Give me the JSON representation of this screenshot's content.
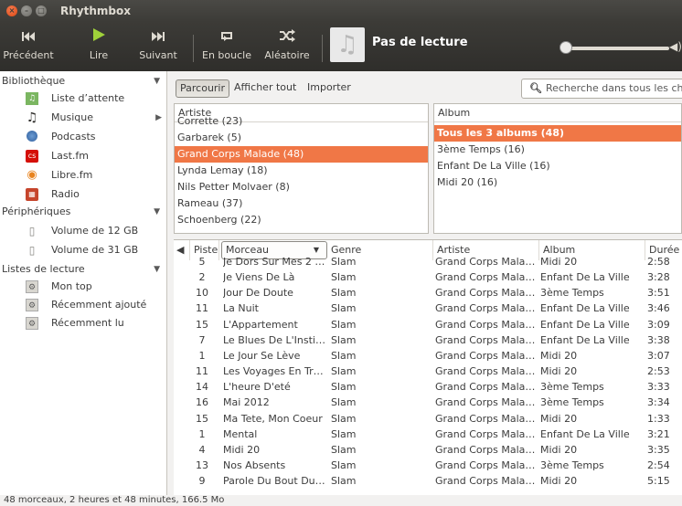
{
  "window": {
    "title": "Rhythmbox"
  },
  "toolbar": {
    "previous": "Précédent",
    "play": "Lire",
    "next": "Suivant",
    "repeat": "En boucle",
    "shuffle": "Aléatoire",
    "now_playing": "Pas de lecture"
  },
  "sidebar": {
    "library_header": "Bibliothèque",
    "library_items": [
      {
        "label": "Liste d’attente",
        "icon": "queue-icon"
      },
      {
        "label": "Musique",
        "icon": "music-icon"
      },
      {
        "label": "Podcasts",
        "icon": "podcast-icon"
      },
      {
        "label": "Last.fm",
        "icon": "lastfm-icon"
      },
      {
        "label": "Libre.fm",
        "icon": "librefm-icon"
      },
      {
        "label": "Radio",
        "icon": "radio-icon"
      }
    ],
    "devices_header": "Périphériques",
    "device_items": [
      {
        "label": "Volume de 12 GB"
      },
      {
        "label": "Volume de 31 GB"
      }
    ],
    "playlists_header": "Listes de lecture",
    "playlist_items": [
      {
        "label": "Mon top"
      },
      {
        "label": "Récemment ajouté"
      },
      {
        "label": "Récemment lu"
      }
    ]
  },
  "browse": {
    "browse_btn": "Parcourir",
    "show_all_btn": "Afficher tout",
    "import_btn": "Importer",
    "search_placeholder": "Recherche dans tous les champs"
  },
  "artist_pane": {
    "header": "Artiste",
    "rows": [
      "Corrette (23)",
      "Garbarek (5)",
      "Grand Corps Malade (48)",
      "Lynda Lemay (18)",
      "Nils Petter Molvaer (8)",
      "Rameau (37)",
      "Schoenberg (22)"
    ]
  },
  "album_pane": {
    "header": "Album",
    "rows": [
      "Tous les 3 albums (48)",
      "3ème Temps (16)",
      "Enfant De La Ville (16)",
      "Midi 20 (16)"
    ]
  },
  "track_table": {
    "headers": {
      "playing": "",
      "track": "Piste",
      "title": "Morceau",
      "genre": "Genre",
      "artist": "Artiste",
      "album": "Album",
      "duration": "Durée"
    },
    "rows": [
      {
        "track": "5",
        "title": "Je Dors Sur Mes 2 Or...",
        "genre": "Slam",
        "artist": "Grand Corps Malade",
        "album": "Midi 20",
        "duration": "2:58"
      },
      {
        "track": "2",
        "title": "Je Viens De Là",
        "genre": "Slam",
        "artist": "Grand Corps Malade",
        "album": "Enfant De La Ville",
        "duration": "3:28"
      },
      {
        "track": "10",
        "title": "Jour De Doute",
        "genre": "Slam",
        "artist": "Grand Corps Malade",
        "album": "3ème Temps",
        "duration": "3:51"
      },
      {
        "track": "11",
        "title": "La Nuit",
        "genre": "Slam",
        "artist": "Grand Corps Malade",
        "album": "Enfant De La Ville",
        "duration": "3:46"
      },
      {
        "track": "15",
        "title": "L'Appartement",
        "genre": "Slam",
        "artist": "Grand Corps Malade",
        "album": "Enfant De La Ville",
        "duration": "3:09"
      },
      {
        "track": "7",
        "title": "Le Blues De L'Instit...",
        "genre": "Slam",
        "artist": "Grand Corps Malade",
        "album": "Enfant De La Ville",
        "duration": "3:38"
      },
      {
        "track": "1",
        "title": "Le Jour Se Lève",
        "genre": "Slam",
        "artist": "Grand Corps Malade",
        "album": "Midi 20",
        "duration": "3:07"
      },
      {
        "track": "11",
        "title": "Les Voyages En Train",
        "genre": "Slam",
        "artist": "Grand Corps Malade",
        "album": "Midi 20",
        "duration": "2:53"
      },
      {
        "track": "14",
        "title": "L'heure D'eté",
        "genre": "Slam",
        "artist": "Grand Corps Malade",
        "album": "3ème Temps",
        "duration": "3:33"
      },
      {
        "track": "16",
        "title": "Mai 2012",
        "genre": "Slam",
        "artist": "Grand Corps Malade",
        "album": "3ème Temps",
        "duration": "3:34"
      },
      {
        "track": "15",
        "title": "Ma Tete, Mon Coeur",
        "genre": "Slam",
        "artist": "Grand Corps Malade",
        "album": "Midi 20",
        "duration": "1:33"
      },
      {
        "track": "1",
        "title": "Mental",
        "genre": "Slam",
        "artist": "Grand Corps Malade",
        "album": "Enfant De La Ville",
        "duration": "3:21"
      },
      {
        "track": "4",
        "title": "Midi 20",
        "genre": "Slam",
        "artist": "Grand Corps Malade",
        "album": "Midi 20",
        "duration": "3:35"
      },
      {
        "track": "13",
        "title": "Nos Absents",
        "genre": "Slam",
        "artist": "Grand Corps Malade",
        "album": "3ème Temps",
        "duration": "2:54"
      },
      {
        "track": "9",
        "title": "Parole Du Bout Du ...",
        "genre": "Slam",
        "artist": "Grand Corps Malade",
        "album": "Midi 20",
        "duration": "5:15"
      }
    ]
  },
  "status": {
    "text": "48 morceaux, 2 heures et 48 minutes, 166.5 Mo"
  },
  "colors": {
    "selection": "#f07746",
    "toolbar": "#3c3b37",
    "close_button": "#dd4814"
  }
}
